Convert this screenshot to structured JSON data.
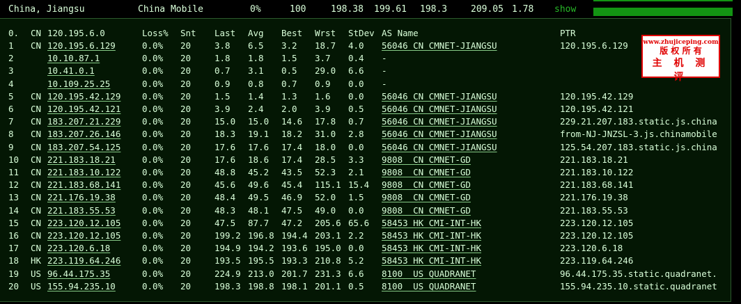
{
  "summary": {
    "location": "China, Jiangsu",
    "isp": "China Mobile",
    "loss": "0%",
    "sent": "100",
    "last": "198.38",
    "avg": "199.61",
    "best": "198.3",
    "worst": "209.05",
    "stdev": "1.78",
    "action": "show"
  },
  "headers": {
    "hop": "0.",
    "cc": "CN",
    "host": "120.195.6.0",
    "loss": "Loss%",
    "snt": "Snt",
    "last": "Last",
    "avg": "Avg",
    "best": "Best",
    "wrst": "Wrst",
    "stdev": "StDev",
    "as": "AS Name",
    "ptr": "PTR"
  },
  "watermark": {
    "url": "www.zhujiceping.com",
    "line2": "版 权 所 有",
    "line3": "主 机 测 评"
  },
  "hops": [
    {
      "hop": "1",
      "cc": "CN",
      "host": "120.195.6.129",
      "loss": "0.0%",
      "snt": "20",
      "last": "3.8",
      "avg": "6.5",
      "best": "3.2",
      "wrst": "18.7",
      "stdev": "4.0",
      "as": "56046 CN CMNET-JIANGSU",
      "ptr": "120.195.6.129"
    },
    {
      "hop": "2",
      "cc": "",
      "host": "10.10.87.1",
      "loss": "0.0%",
      "snt": "20",
      "last": "1.8",
      "avg": "1.8",
      "best": "1.5",
      "wrst": "3.7",
      "stdev": "0.4",
      "as": "-",
      "ptr": ""
    },
    {
      "hop": "3",
      "cc": "",
      "host": "10.41.0.1",
      "loss": "0.0%",
      "snt": "20",
      "last": "0.7",
      "avg": "3.1",
      "best": "0.5",
      "wrst": "29.0",
      "stdev": "6.6",
      "as": "-",
      "ptr": ""
    },
    {
      "hop": "4",
      "cc": "",
      "host": "10.109.25.25",
      "loss": "0.0%",
      "snt": "20",
      "last": "0.9",
      "avg": "0.8",
      "best": "0.7",
      "wrst": "0.9",
      "stdev": "0.0",
      "as": "-",
      "ptr": ""
    },
    {
      "hop": "5",
      "cc": "CN",
      "host": "120.195.42.129",
      "loss": "0.0%",
      "snt": "20",
      "last": "1.5",
      "avg": "1.4",
      "best": "1.3",
      "wrst": "1.6",
      "stdev": "0.0",
      "as": "56046 CN CMNET-JIANGSU",
      "ptr": "120.195.42.129"
    },
    {
      "hop": "6",
      "cc": "CN",
      "host": "120.195.42.121",
      "loss": "0.0%",
      "snt": "20",
      "last": "3.9",
      "avg": "2.4",
      "best": "2.0",
      "wrst": "3.9",
      "stdev": "0.5",
      "as": "56046 CN CMNET-JIANGSU",
      "ptr": "120.195.42.121"
    },
    {
      "hop": "7",
      "cc": "CN",
      "host": "183.207.21.229",
      "loss": "0.0%",
      "snt": "20",
      "last": "15.0",
      "avg": "15.0",
      "best": "14.6",
      "wrst": "17.8",
      "stdev": "0.7",
      "as": "56046 CN CMNET-JIANGSU",
      "ptr": "229.21.207.183.static.js.china"
    },
    {
      "hop": "8",
      "cc": "CN",
      "host": "183.207.26.146",
      "loss": "0.0%",
      "snt": "20",
      "last": "18.3",
      "avg": "19.1",
      "best": "18.2",
      "wrst": "31.0",
      "stdev": "2.8",
      "as": "56046 CN CMNET-JIANGSU",
      "ptr": "from-NJ-JNZSL-3.js.chinamobile"
    },
    {
      "hop": "9",
      "cc": "CN",
      "host": "183.207.54.125",
      "loss": "0.0%",
      "snt": "20",
      "last": "17.6",
      "avg": "17.6",
      "best": "17.4",
      "wrst": "18.0",
      "stdev": "0.0",
      "as": "56046 CN CMNET-JIANGSU",
      "ptr": "125.54.207.183.static.js.china"
    },
    {
      "hop": "10",
      "cc": "CN",
      "host": "221.183.18.21",
      "loss": "0.0%",
      "snt": "20",
      "last": "17.6",
      "avg": "18.6",
      "best": "17.4",
      "wrst": "28.5",
      "stdev": "3.3",
      "as": "9808  CN CMNET-GD",
      "ptr": "221.183.18.21"
    },
    {
      "hop": "11",
      "cc": "CN",
      "host": "221.183.10.122",
      "loss": "0.0%",
      "snt": "20",
      "last": "48.8",
      "avg": "45.2",
      "best": "43.5",
      "wrst": "52.3",
      "stdev": "2.1",
      "as": "9808  CN CMNET-GD",
      "ptr": "221.183.10.122"
    },
    {
      "hop": "12",
      "cc": "CN",
      "host": "221.183.68.141",
      "loss": "0.0%",
      "snt": "20",
      "last": "45.6",
      "avg": "49.6",
      "best": "45.4",
      "wrst": "115.1",
      "stdev": "15.4",
      "as": "9808  CN CMNET-GD",
      "ptr": "221.183.68.141"
    },
    {
      "hop": "13",
      "cc": "CN",
      "host": "221.176.19.38",
      "loss": "0.0%",
      "snt": "20",
      "last": "48.4",
      "avg": "49.5",
      "best": "46.9",
      "wrst": "52.0",
      "stdev": "1.5",
      "as": "9808  CN CMNET-GD",
      "ptr": "221.176.19.38"
    },
    {
      "hop": "14",
      "cc": "CN",
      "host": "221.183.55.53",
      "loss": "0.0%",
      "snt": "20",
      "last": "48.3",
      "avg": "48.1",
      "best": "47.5",
      "wrst": "49.0",
      "stdev": "0.0",
      "as": "9808  CN CMNET-GD",
      "ptr": "221.183.55.53"
    },
    {
      "hop": "15",
      "cc": "CN",
      "host": "223.120.12.105",
      "loss": "0.0%",
      "snt": "20",
      "last": "47.5",
      "avg": "87.7",
      "best": "47.2",
      "wrst": "205.6",
      "stdev": "65.6",
      "as": "58453 HK CMI-INT-HK",
      "ptr": "223.120.12.105"
    },
    {
      "hop": "16",
      "cc": "CN",
      "host": "223.120.12.105",
      "loss": "0.0%",
      "snt": "20",
      "last": "199.2",
      "avg": "196.8",
      "best": "194.4",
      "wrst": "203.1",
      "stdev": "2.2",
      "as": "58453 HK CMI-INT-HK",
      "ptr": "223.120.12.105"
    },
    {
      "hop": "17",
      "cc": "CN",
      "host": "223.120.6.18",
      "loss": "0.0%",
      "snt": "20",
      "last": "194.9",
      "avg": "194.2",
      "best": "193.6",
      "wrst": "195.0",
      "stdev": "0.0",
      "as": "58453 HK CMI-INT-HK",
      "ptr": "223.120.6.18"
    },
    {
      "hop": "18",
      "cc": "HK",
      "host": "223.119.64.246",
      "loss": "0.0%",
      "snt": "20",
      "last": "193.5",
      "avg": "195.5",
      "best": "193.3",
      "wrst": "210.8",
      "stdev": "5.2",
      "as": "58453 HK CMI-INT-HK",
      "ptr": "223.119.64.246"
    },
    {
      "hop": "19",
      "cc": "US",
      "host": "96.44.175.35",
      "loss": "0.0%",
      "snt": "20",
      "last": "224.9",
      "avg": "213.0",
      "best": "201.7",
      "wrst": "231.3",
      "stdev": "6.6",
      "as": "8100  US QUADRANET",
      "ptr": "96.44.175.35.static.quadranet."
    },
    {
      "hop": "20",
      "cc": "US",
      "host": "155.94.235.10",
      "loss": "0.0%",
      "snt": "20",
      "last": "198.3",
      "avg": "198.8",
      "best": "198.1",
      "wrst": "201.1",
      "stdev": "0.5",
      "as": "8100  US QUADRANET",
      "ptr": "155.94.235.10.static.quadranet"
    }
  ]
}
